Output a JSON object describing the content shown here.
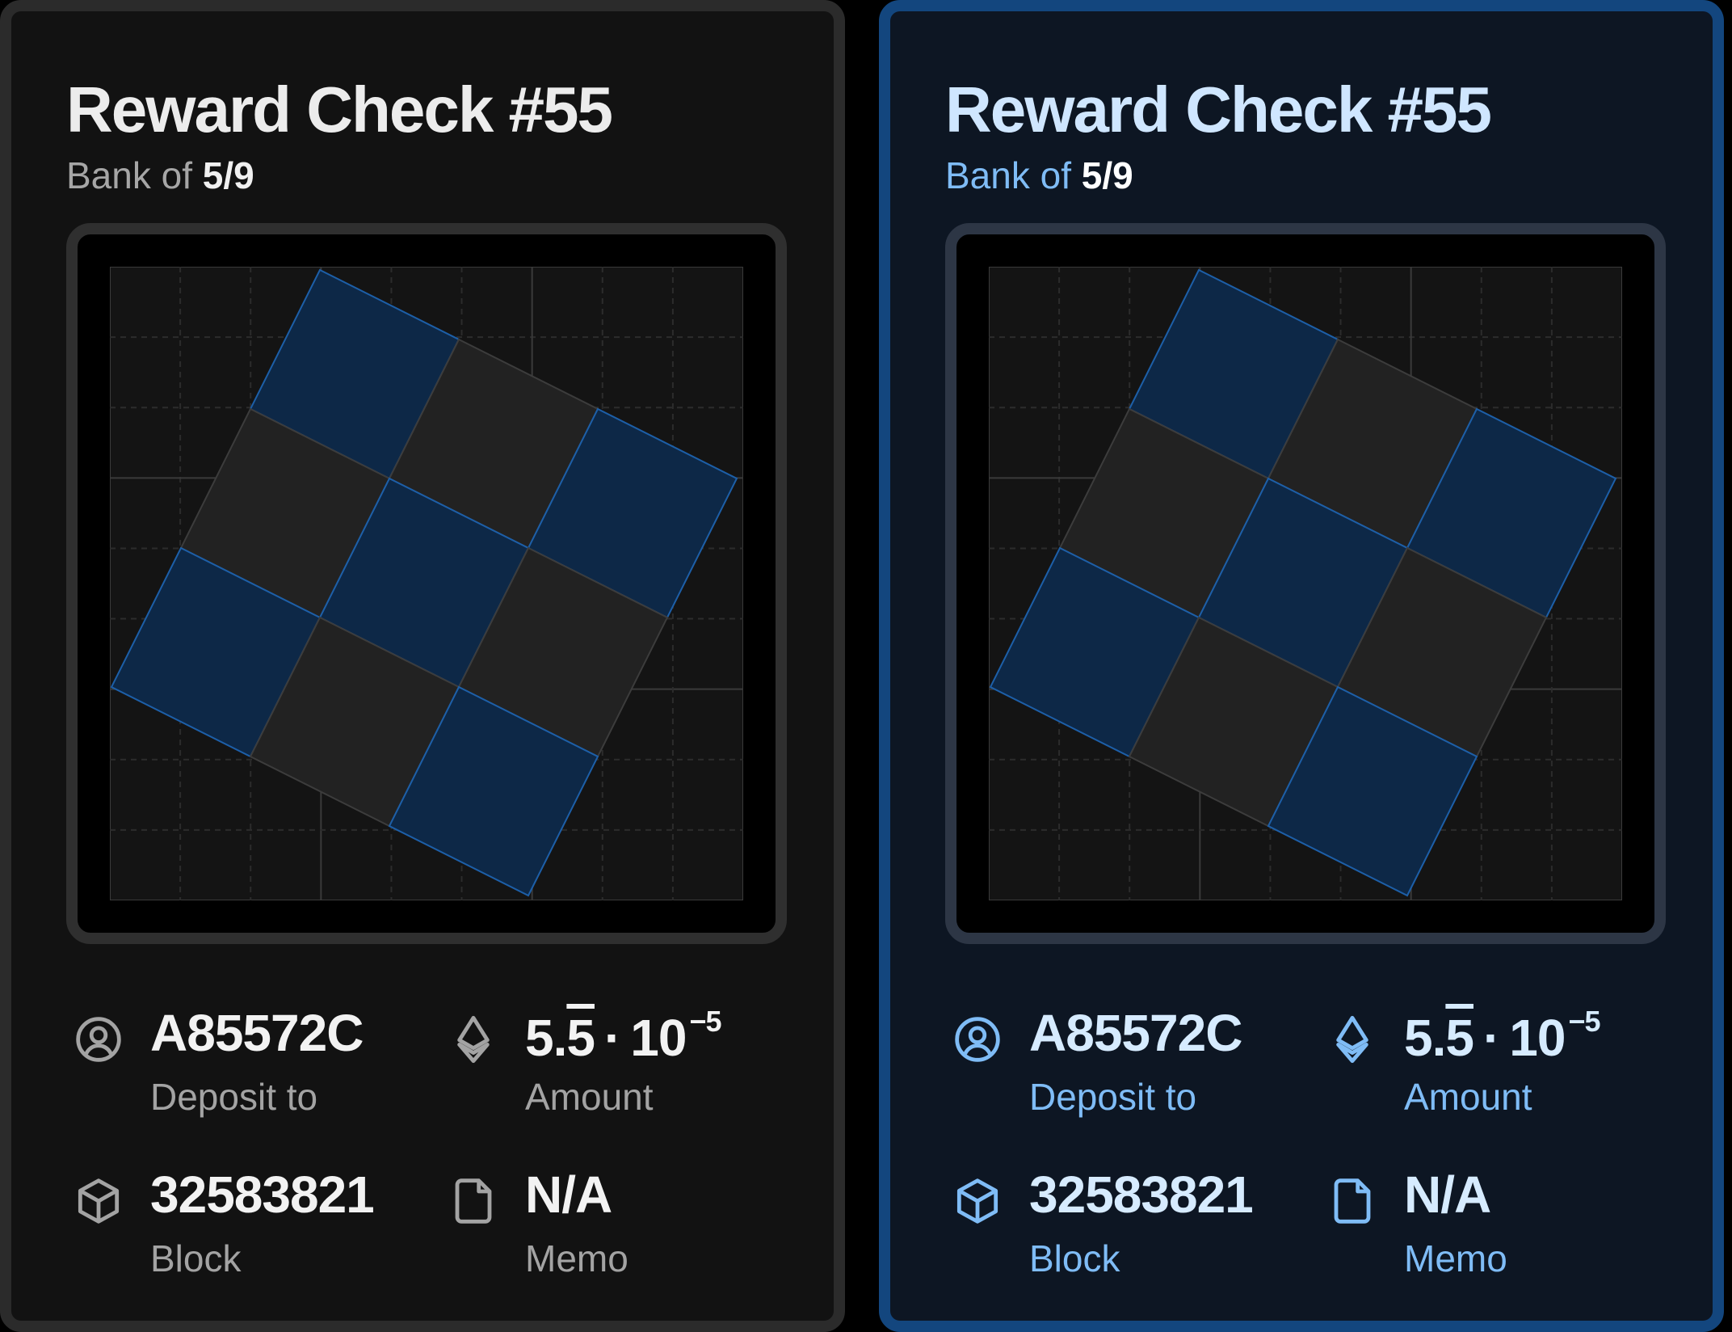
{
  "cards": [
    {
      "state": "default",
      "title": "Reward Check #55",
      "subtitle_label": "Bank of",
      "subtitle_value": "5/9",
      "deposit_value": "A85572C",
      "deposit_label": "Deposit to",
      "amount_mantissa_int": "5.",
      "amount_mantissa_rep": "5",
      "amount_dot": "·",
      "amount_base": "10",
      "amount_exp": "−5",
      "amount_label": "Amount",
      "block_value": "32583821",
      "block_label": "Block",
      "memo_value": "N/A",
      "memo_label": "Memo"
    },
    {
      "state": "selected",
      "title": "Reward Check #55",
      "subtitle_label": "Bank of",
      "subtitle_value": "5/9",
      "deposit_value": "A85572C",
      "deposit_label": "Deposit to",
      "amount_mantissa_int": "5.",
      "amount_mantissa_rep": "5",
      "amount_dot": "·",
      "amount_base": "10",
      "amount_exp": "−5",
      "amount_label": "Amount",
      "block_value": "32583821",
      "block_label": "Block",
      "memo_value": "N/A",
      "memo_label": "Memo"
    }
  ],
  "icons": {
    "deposit": "user-circle-icon",
    "amount": "ethereum-icon",
    "block": "cube-icon",
    "memo": "file-icon"
  },
  "colors": {
    "blue_tile": "#0d2847",
    "gray_tile": "#222222",
    "blue_accent": "#7fbcf6",
    "selected_border": "#13467e"
  },
  "board_pattern": [
    [
      "blue",
      "gray",
      "blue"
    ],
    [
      "gray",
      "blue",
      "gray"
    ],
    [
      "blue",
      "gray",
      "blue"
    ]
  ]
}
